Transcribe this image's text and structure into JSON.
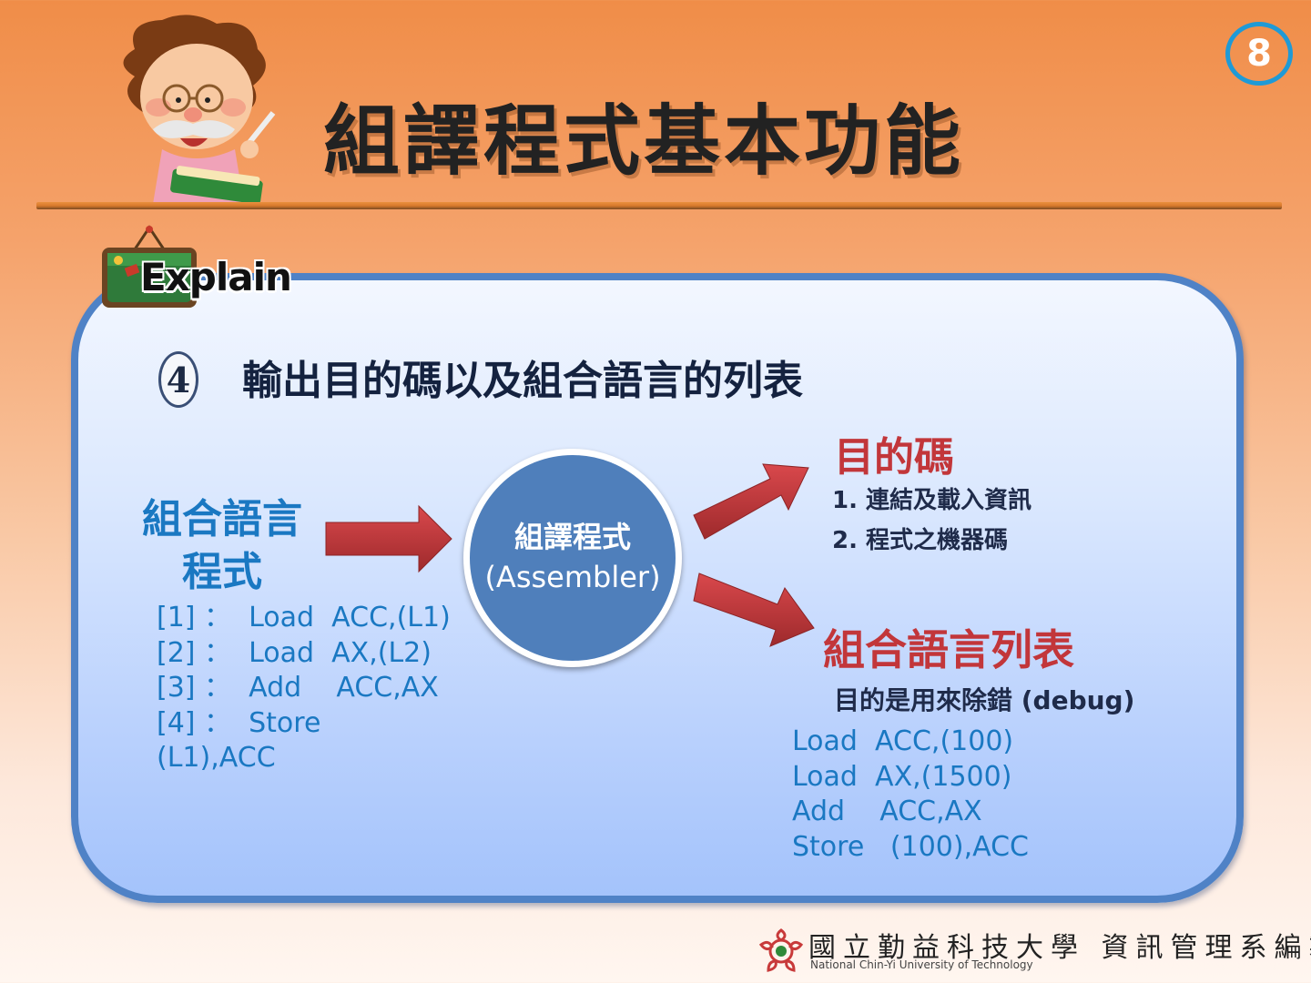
{
  "slide": {
    "page_number": "8",
    "title": "組譯程式基本功能",
    "badge_label": "Explain"
  },
  "section": {
    "number": "4",
    "heading": "輸出目的碼以及組合語言的列表"
  },
  "source": {
    "title_line1": "組合語言",
    "title_line2": "程式",
    "code": "[1] ：  Load  ACC,(L1)\n[2] ：  Load  AX,(L2)\n[3] ：  Add    ACC,AX\n[4] ：  Store\n(L1),ACC"
  },
  "assembler": {
    "line1": "組譯程式",
    "line2": "(Assembler)"
  },
  "object_code": {
    "title": "目的碼",
    "items": [
      "1.  連結及載入資訊",
      "2.  程式之機器碼"
    ]
  },
  "listing": {
    "title": "組合語言列表",
    "description": "目的是用來除錯  (debug)",
    "code": "Load  ACC,(100)\nLoad  AX,(1500)\nAdd    ACC,AX\nStore   (100),ACC"
  },
  "footer": {
    "chinese": "國立勤益科技大學 資訊管理系編製",
    "english": "National Chin-Yi University of Technology"
  },
  "colors": {
    "accent_blue": "#1a78c2",
    "accent_red": "#c2363a",
    "panel_border": "#4f82c6"
  }
}
